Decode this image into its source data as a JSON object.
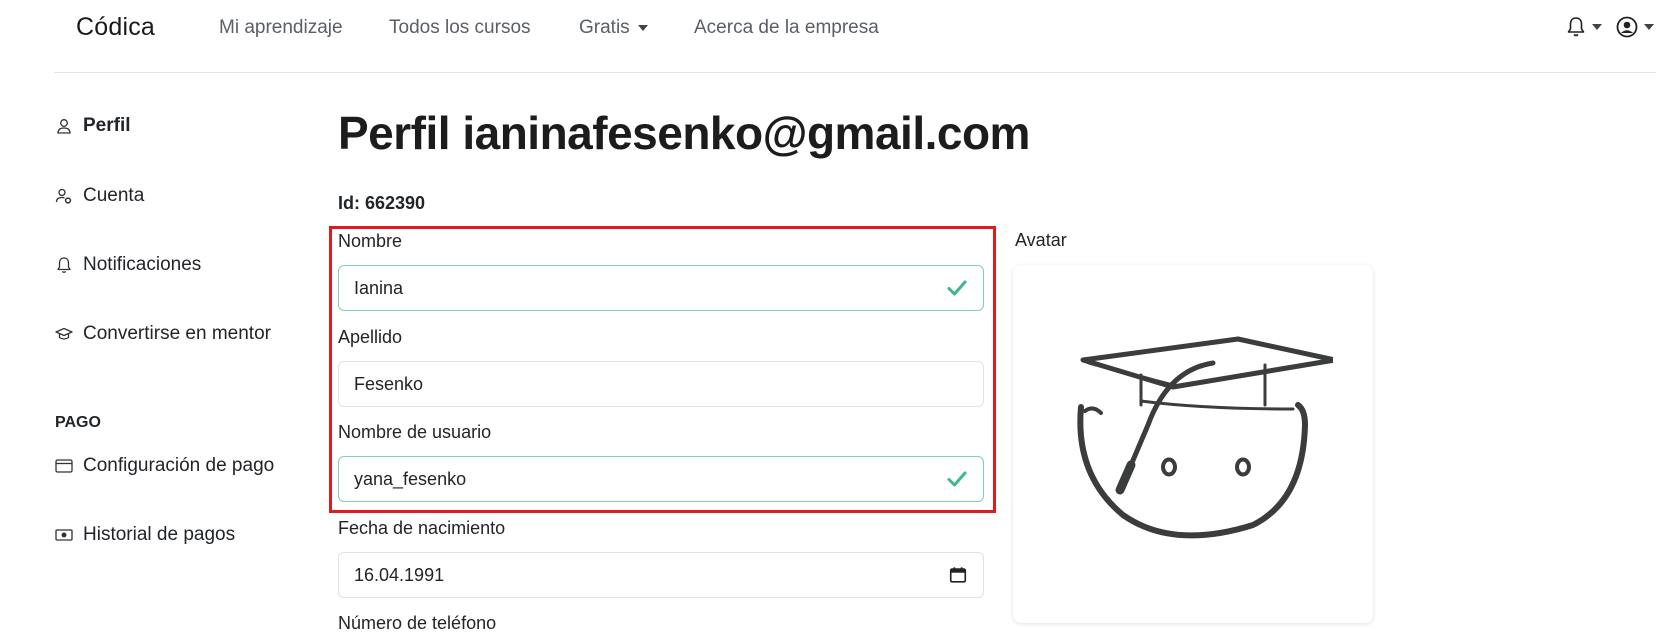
{
  "nav": {
    "logo": "Códica",
    "links": [
      "Mi aprendizaje",
      "Todos los cursos",
      "Gratis",
      "Acerca de la empresa"
    ]
  },
  "sidebar": {
    "items": [
      {
        "label": "Perfil",
        "icon": "user-icon"
      },
      {
        "label": "Cuenta",
        "icon": "user-gear-icon"
      },
      {
        "label": "Notificaciones",
        "icon": "bell-icon"
      },
      {
        "label": "Convertirse en mentor",
        "icon": "graduation-cap-icon"
      }
    ],
    "payment_heading": "PAGO",
    "payment_items": [
      {
        "label": "Configuración de pago",
        "icon": "card-icon"
      },
      {
        "label": "Historial de pagos",
        "icon": "money-icon"
      }
    ]
  },
  "main": {
    "title": "Perfil ianinafesenko@gmail.com",
    "id_text": "Id: 662390",
    "fields": {
      "first_name": {
        "label": "Nombre",
        "value": "Ianina"
      },
      "last_name": {
        "label": "Apellido",
        "value": "Fesenko"
      },
      "username": {
        "label": "Nombre de usuario",
        "value": "yana_fesenko"
      },
      "birthdate": {
        "label": "Fecha de nacimiento",
        "value": "16.04.1991"
      },
      "phone": {
        "label": "Número de teléfono"
      }
    },
    "avatar_label": "Avatar"
  },
  "colors": {
    "accent_valid": "#3fb68b",
    "highlight": "#e01b1b"
  }
}
